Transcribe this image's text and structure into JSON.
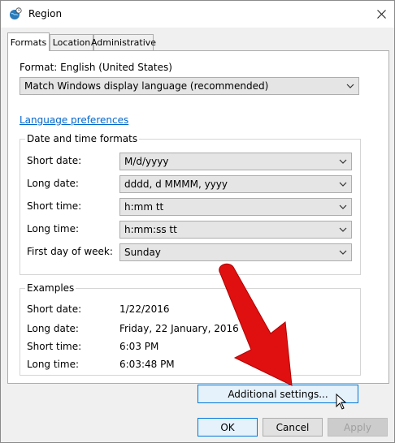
{
  "window": {
    "title": "Region",
    "icon": "globe-clock-icon",
    "close_icon": "close-icon"
  },
  "tabs": [
    {
      "label": "Formats",
      "active": true
    },
    {
      "label": "Location",
      "active": false
    },
    {
      "label": "Administrative",
      "active": false
    }
  ],
  "format": {
    "label": "Format: English (United States)",
    "dropdown_value": "Match Windows display language (recommended)"
  },
  "language_preferences_link": "Language preferences",
  "date_time_formats": {
    "title": "Date and time formats",
    "rows": [
      {
        "label": "Short date:",
        "value": "M/d/yyyy"
      },
      {
        "label": "Long date:",
        "value": "dddd, d MMMM, yyyy"
      },
      {
        "label": "Short time:",
        "value": "h:mm tt"
      },
      {
        "label": "Long time:",
        "value": "h:mm:ss tt"
      },
      {
        "label": "First day of week:",
        "value": "Sunday"
      }
    ]
  },
  "examples": {
    "title": "Examples",
    "rows": [
      {
        "label": "Short date:",
        "value": "1/22/2016"
      },
      {
        "label": "Long date:",
        "value": "Friday, 22 January, 2016"
      },
      {
        "label": "Short time:",
        "value": "6:03 PM"
      },
      {
        "label": "Long time:",
        "value": "6:03:48 PM"
      }
    ]
  },
  "buttons": {
    "additional_settings": "Additional settings...",
    "ok": "OK",
    "cancel": "Cancel",
    "apply": "Apply"
  },
  "colors": {
    "link": "#0066cc",
    "focus_border": "#0078d7",
    "arrow": "#e01010"
  }
}
